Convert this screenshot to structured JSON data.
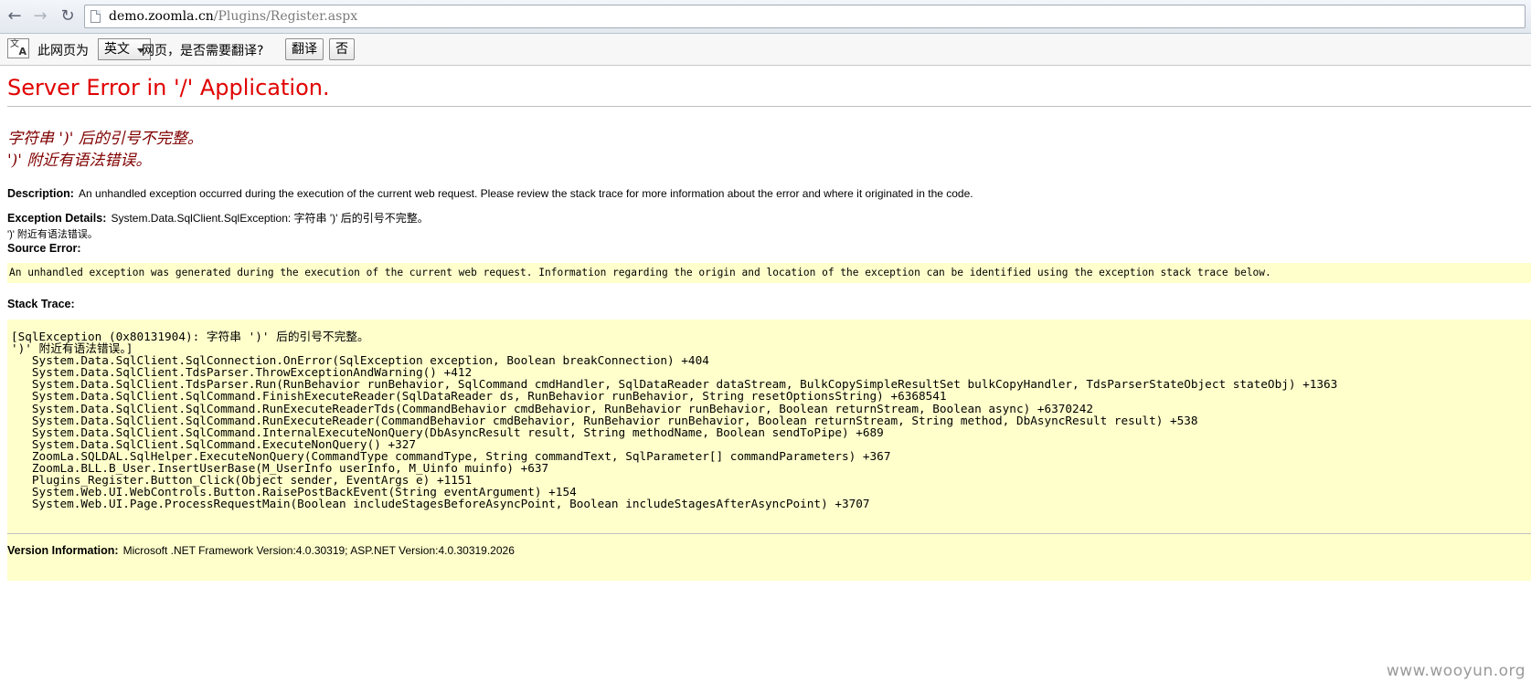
{
  "browser": {
    "url_host": "demo.zoomla.cn",
    "url_path": "/Plugins/Register.aspx"
  },
  "translate_bar": {
    "icon_glyphs": [
      "文",
      "A"
    ],
    "prompt_prefix": "此网页为",
    "language": "英文",
    "prompt_suffix": "网页，是否需要翻译?",
    "translate_button": "翻译",
    "no_button": "否"
  },
  "page": {
    "title": "Server Error in '/' Application.",
    "error_lines": [
      "字符串 ')' 后的引号不完整。",
      "')' 附近有语法错误。"
    ],
    "description_label": "Description:",
    "description_text": "An unhandled exception occurred during the execution of the current web request. Please review the stack trace for more information about the error and where it originated in the code.",
    "exception_label": "Exception Details:",
    "exception_text": "System.Data.SqlClient.SqlException: 字符串 ')' 后的引号不完整。",
    "exception_text_2": "')' 附近有语法错误。",
    "source_label": "Source Error:",
    "source_text": "An unhandled exception was generated during the execution of the current web request. Information regarding the origin and location of the exception can be identified using the exception stack trace below.",
    "stack_label": "Stack Trace:",
    "stack_lines": [
      "[SqlException (0x80131904): 字符串 ')' 后的引号不完整。",
      "')' 附近有语法错误。]",
      "   System.Data.SqlClient.SqlConnection.OnError(SqlException exception, Boolean breakConnection) +404",
      "   System.Data.SqlClient.TdsParser.ThrowExceptionAndWarning() +412",
      "   System.Data.SqlClient.TdsParser.Run(RunBehavior runBehavior, SqlCommand cmdHandler, SqlDataReader dataStream, BulkCopySimpleResultSet bulkCopyHandler, TdsParserStateObject stateObj) +1363",
      "   System.Data.SqlClient.SqlCommand.FinishExecuteReader(SqlDataReader ds, RunBehavior runBehavior, String resetOptionsString) +6368541",
      "   System.Data.SqlClient.SqlCommand.RunExecuteReaderTds(CommandBehavior cmdBehavior, RunBehavior runBehavior, Boolean returnStream, Boolean async) +6370242",
      "   System.Data.SqlClient.SqlCommand.RunExecuteReader(CommandBehavior cmdBehavior, RunBehavior runBehavior, Boolean returnStream, String method, DbAsyncResult result) +538",
      "   System.Data.SqlClient.SqlCommand.InternalExecuteNonQuery(DbAsyncResult result, String methodName, Boolean sendToPipe) +689",
      "   System.Data.SqlClient.SqlCommand.ExecuteNonQuery() +327",
      "   ZoomLa.SQLDAL.SqlHelper.ExecuteNonQuery(CommandType commandType, String commandText, SqlParameter[] commandParameters) +367",
      "   ZoomLa.BLL.B_User.InsertUserBase(M_UserInfo userInfo, M_Uinfo muinfo) +637",
      "   Plugins_Register.Button_Click(Object sender, EventArgs e) +1151",
      "   System.Web.UI.WebControls.Button.RaisePostBackEvent(String eventArgument) +154",
      "   System.Web.UI.Page.ProcessRequestMain(Boolean includeStagesBeforeAsyncPoint, Boolean includeStagesAfterAsyncPoint) +3707"
    ],
    "version_label": "Version Information:",
    "version_text": "Microsoft .NET Framework Version:4.0.30319; ASP.NET Version:4.0.30319.2026"
  },
  "watermark": "www.wooyun.org",
  "colors": {
    "title_red": "#e00000",
    "error_message": "#800000",
    "code_background": "#ffffcc"
  }
}
